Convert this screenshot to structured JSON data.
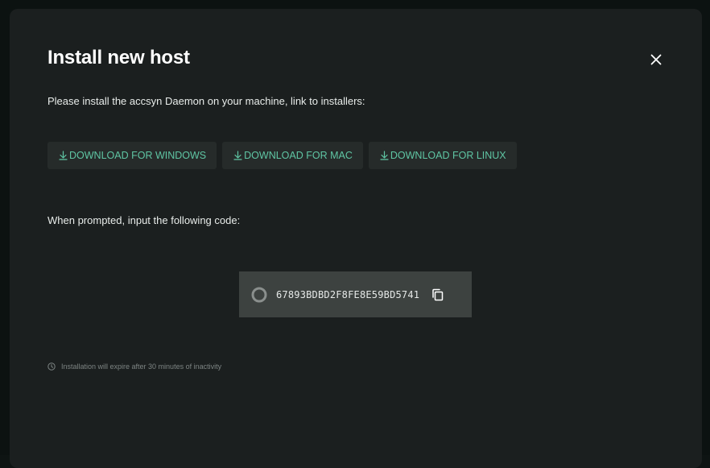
{
  "dialog": {
    "title": "Install new host",
    "close_icon": "close-icon",
    "intro": "Please install the accsyn Daemon on your machine, link to installers:",
    "downloads": [
      {
        "label": "DOWNLOAD FOR WINDOWS",
        "icon": "download-icon"
      },
      {
        "label": "DOWNLOAD FOR MAC",
        "icon": "download-icon"
      },
      {
        "label": "DOWNLOAD FOR LINUX",
        "icon": "download-icon"
      }
    ],
    "prompt": "When prompted, input the following code:",
    "code": {
      "value": "67893BDBD2F8FE8E59BD5741",
      "status_icon": "loading-spinner-icon",
      "copy_icon": "copy-icon"
    },
    "expire_note": "Installation will expire after 30 minutes of inactivity",
    "expire_icon": "clock-icon"
  },
  "colors": {
    "dialog_bg": "#1b1f1f",
    "accent": "#5fc6a4",
    "button_bg": "#262b2a",
    "code_bg": "#3d4240"
  }
}
